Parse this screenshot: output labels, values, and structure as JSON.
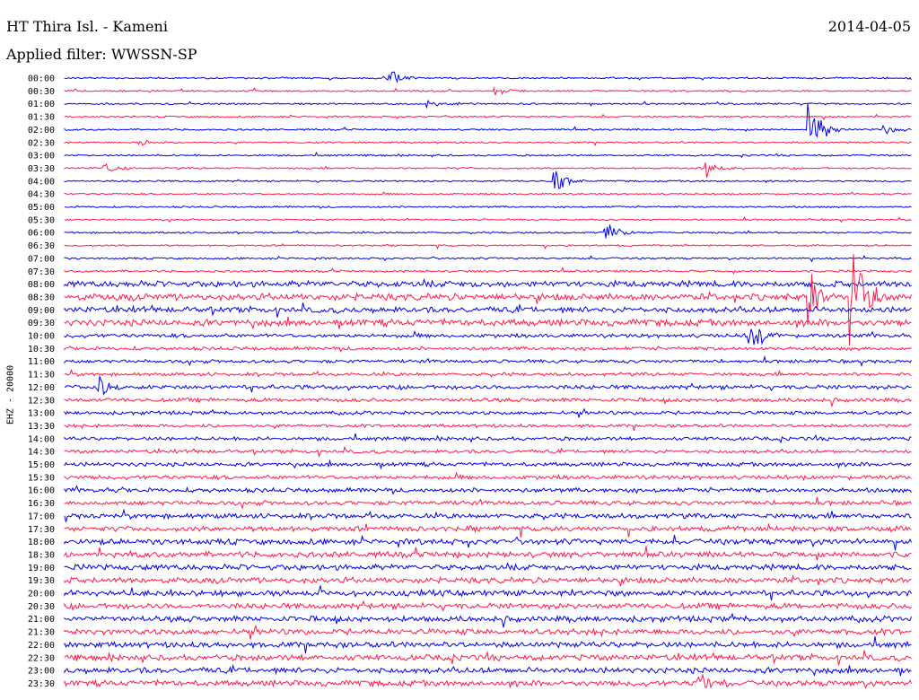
{
  "header": {
    "station": "HT Thira Isl. - Kameni",
    "date": "2014-04-05",
    "filter": "Applied filter: WWSSN-SP"
  },
  "channel_label": "EHZ - 20000",
  "colors": {
    "trace_a": "#0000ee",
    "trace_b": "#ff1a4a",
    "text": "#000000"
  },
  "chart_data": {
    "type": "line",
    "kind": "helicorder",
    "grid": false,
    "row_labels": [
      "00:00",
      "00:30",
      "01:00",
      "01:30",
      "02:00",
      "02:30",
      "03:00",
      "03:30",
      "04:00",
      "04:30",
      "05:00",
      "05:30",
      "06:00",
      "06:30",
      "07:00",
      "07:30",
      "08:00",
      "08:30",
      "09:00",
      "09:30",
      "10:00",
      "10:30",
      "11:00",
      "11:30",
      "12:00",
      "12:30",
      "13:00",
      "13:30",
      "14:00",
      "14:30",
      "15:00",
      "15:30",
      "16:00",
      "16:30",
      "17:00",
      "17:30",
      "18:00",
      "18:30",
      "19:00",
      "19:30",
      "20:00",
      "20:30",
      "21:00",
      "21:30",
      "22:00",
      "22:30",
      "23:00",
      "23:30"
    ],
    "row_colors": [
      "blue",
      "red"
    ],
    "noise_level": [
      0.8,
      0.8,
      0.8,
      0.8,
      0.8,
      0.8,
      0.8,
      0.8,
      0.8,
      0.8,
      0.8,
      0.8,
      0.8,
      0.8,
      0.9,
      1.0,
      2.8,
      3.0,
      2.6,
      3.0,
      1.8,
      1.6,
      1.5,
      1.5,
      1.9,
      1.8,
      1.6,
      1.5,
      1.6,
      1.6,
      1.8,
      1.9,
      2.0,
      2.0,
      2.2,
      2.4,
      2.6,
      2.6,
      2.6,
      2.6,
      2.6,
      2.6,
      2.6,
      2.6,
      2.6,
      2.6,
      2.6,
      2.6
    ],
    "events": [
      {
        "row": 0,
        "x": 0.38,
        "amp": 14
      },
      {
        "row": 1,
        "x": 0.51,
        "amp": 5
      },
      {
        "row": 2,
        "x": 0.43,
        "amp": 5
      },
      {
        "row": 4,
        "x": 0.97,
        "amp": 5
      },
      {
        "row": 4,
        "x": 0.88,
        "amp": 40
      },
      {
        "row": 5,
        "x": 0.09,
        "amp": 4
      },
      {
        "row": 7,
        "x": 0.05,
        "amp": 6
      },
      {
        "row": 7,
        "x": 0.76,
        "amp": 10
      },
      {
        "row": 8,
        "x": 0.58,
        "amp": 14
      },
      {
        "row": 12,
        "x": 0.64,
        "amp": 12
      },
      {
        "row": 17,
        "x": 0.88,
        "amp": 30
      },
      {
        "row": 17,
        "x": 0.93,
        "amp": 90
      },
      {
        "row": 20,
        "x": 0.81,
        "amp": 15
      },
      {
        "row": 24,
        "x": 0.04,
        "amp": 14
      },
      {
        "row": 47,
        "x": 0.75,
        "amp": 16
      }
    ]
  }
}
